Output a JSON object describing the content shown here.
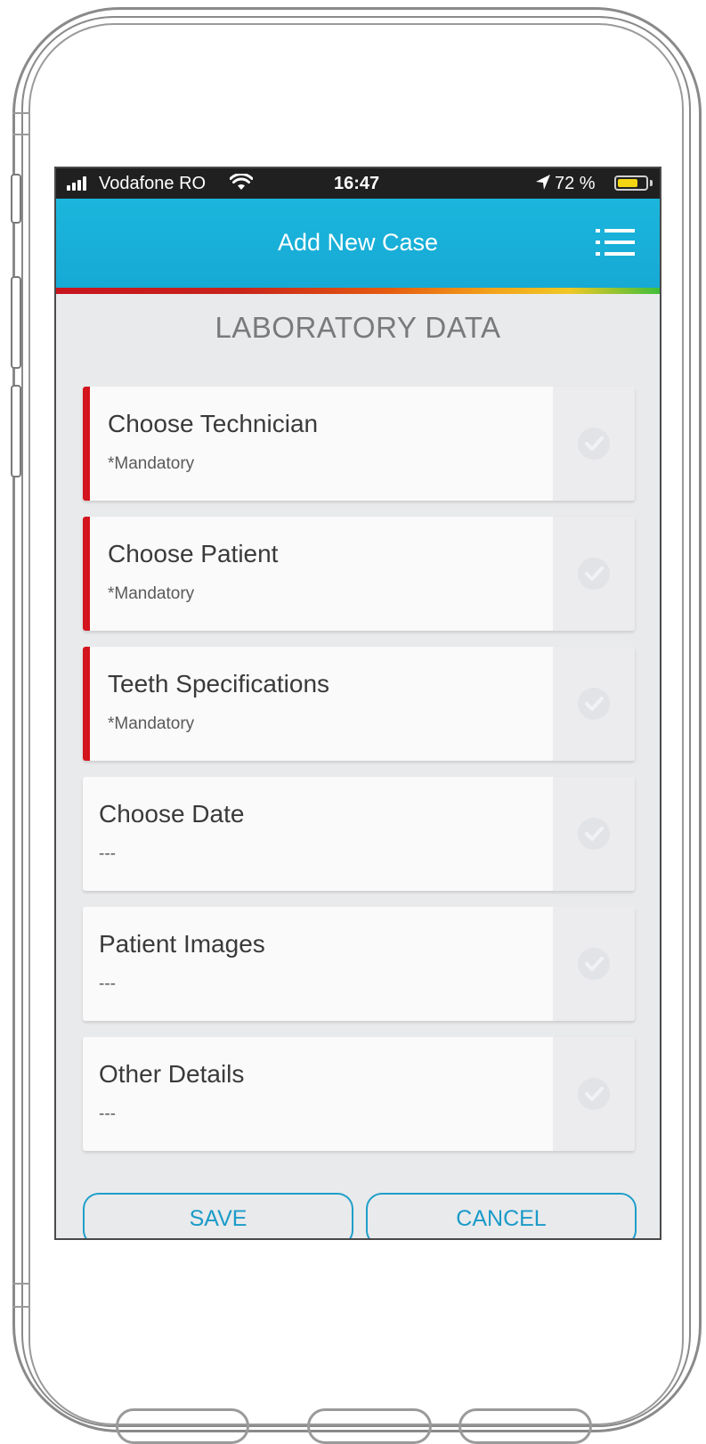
{
  "status_bar": {
    "carrier": "Vodafone RO",
    "time": "16:47",
    "battery_percent": "72 %",
    "battery_level": 0.72,
    "icons": [
      "signal-icon",
      "wifi-icon",
      "location-arrow-icon",
      "battery-icon"
    ]
  },
  "header": {
    "title": "Add New Case",
    "menu_icon": "list-menu-icon"
  },
  "section": {
    "title": "LABORATORY DATA"
  },
  "cards": [
    {
      "label": "Choose Technician",
      "sub": "*Mandatory",
      "mandatory": true,
      "icon": "check-circle-icon"
    },
    {
      "label": "Choose Patient",
      "sub": "*Mandatory",
      "mandatory": true,
      "icon": "check-circle-icon"
    },
    {
      "label": "Teeth Specifications",
      "sub": "*Mandatory",
      "mandatory": true,
      "icon": "check-circle-icon"
    },
    {
      "label": "Choose Date",
      "sub": "---",
      "mandatory": false,
      "icon": "check-circle-icon"
    },
    {
      "label": "Patient Images",
      "sub": "---",
      "mandatory": false,
      "icon": "check-circle-icon"
    },
    {
      "label": "Other Details",
      "sub": "---",
      "mandatory": false,
      "icon": "check-circle-icon"
    }
  ],
  "buttons": {
    "save": "SAVE",
    "cancel": "CANCEL"
  },
  "colors": {
    "header": "#16a9d5",
    "mandatory_bar": "#d4141c",
    "button_outline": "#1f9fc9",
    "background": "#e9eaec"
  }
}
